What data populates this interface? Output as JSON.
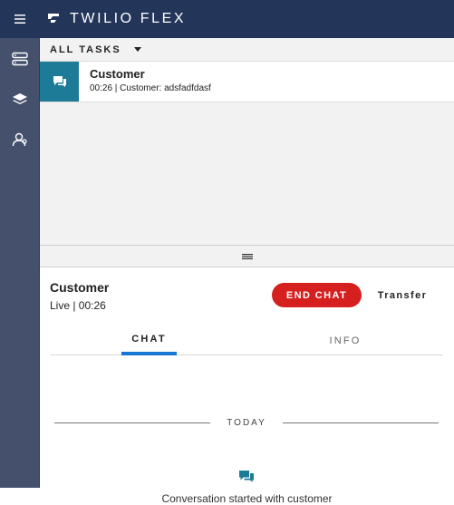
{
  "app": {
    "title": "TWILIO FLEX"
  },
  "sidebar": {
    "items": [
      {
        "icon": "agent-desktop-icon"
      },
      {
        "icon": "layers-icon"
      },
      {
        "icon": "supervisor-icon"
      }
    ]
  },
  "tasks": {
    "filter_label": "ALL TASKS",
    "items": [
      {
        "name": "Customer",
        "subtitle": "00:26 | Customer: adsfadfdasf",
        "channel_icon": "chat-bubble-icon"
      }
    ]
  },
  "task_detail": {
    "customer_name": "Customer",
    "status": "Live | 00:26",
    "end_chat_label": "END CHAT",
    "transfer_label": "Transfer",
    "tabs": [
      {
        "label": "CHAT",
        "active": true
      },
      {
        "label": "INFO",
        "active": false
      }
    ]
  },
  "chat": {
    "date_divider": "TODAY",
    "system_message": "Conversation started with customer"
  },
  "colors": {
    "topbar": "#233659",
    "sidebar": "#44506c",
    "task_icon_bg": "#1e7b97",
    "end_chat": "#d61f1f",
    "active_tab": "#1976d2"
  }
}
